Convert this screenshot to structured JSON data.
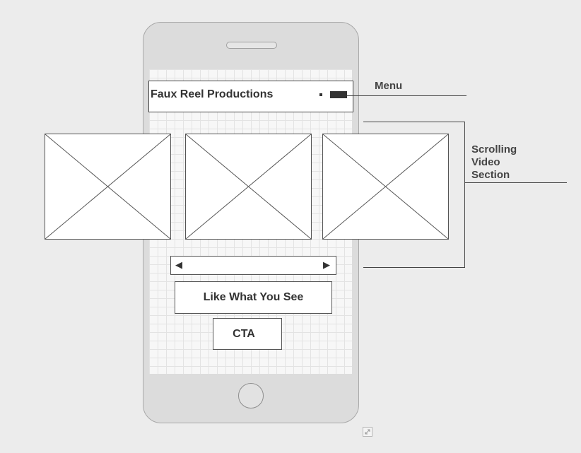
{
  "header": {
    "title": "Faux Reel Productions"
  },
  "annotations": {
    "menu": "Menu",
    "scrolling_video_section": [
      "Scrolling",
      "Video",
      "Section"
    ]
  },
  "video_section": {
    "placeholder_count": 3
  },
  "pager": {
    "prev_glyph": "◀",
    "next_glyph": "▶"
  },
  "buttons": {
    "like_label": "Like What You See",
    "cta_label": "CTA"
  },
  "icons": [
    "menu-icon",
    "image-placeholder-icon",
    "resize-icon"
  ]
}
